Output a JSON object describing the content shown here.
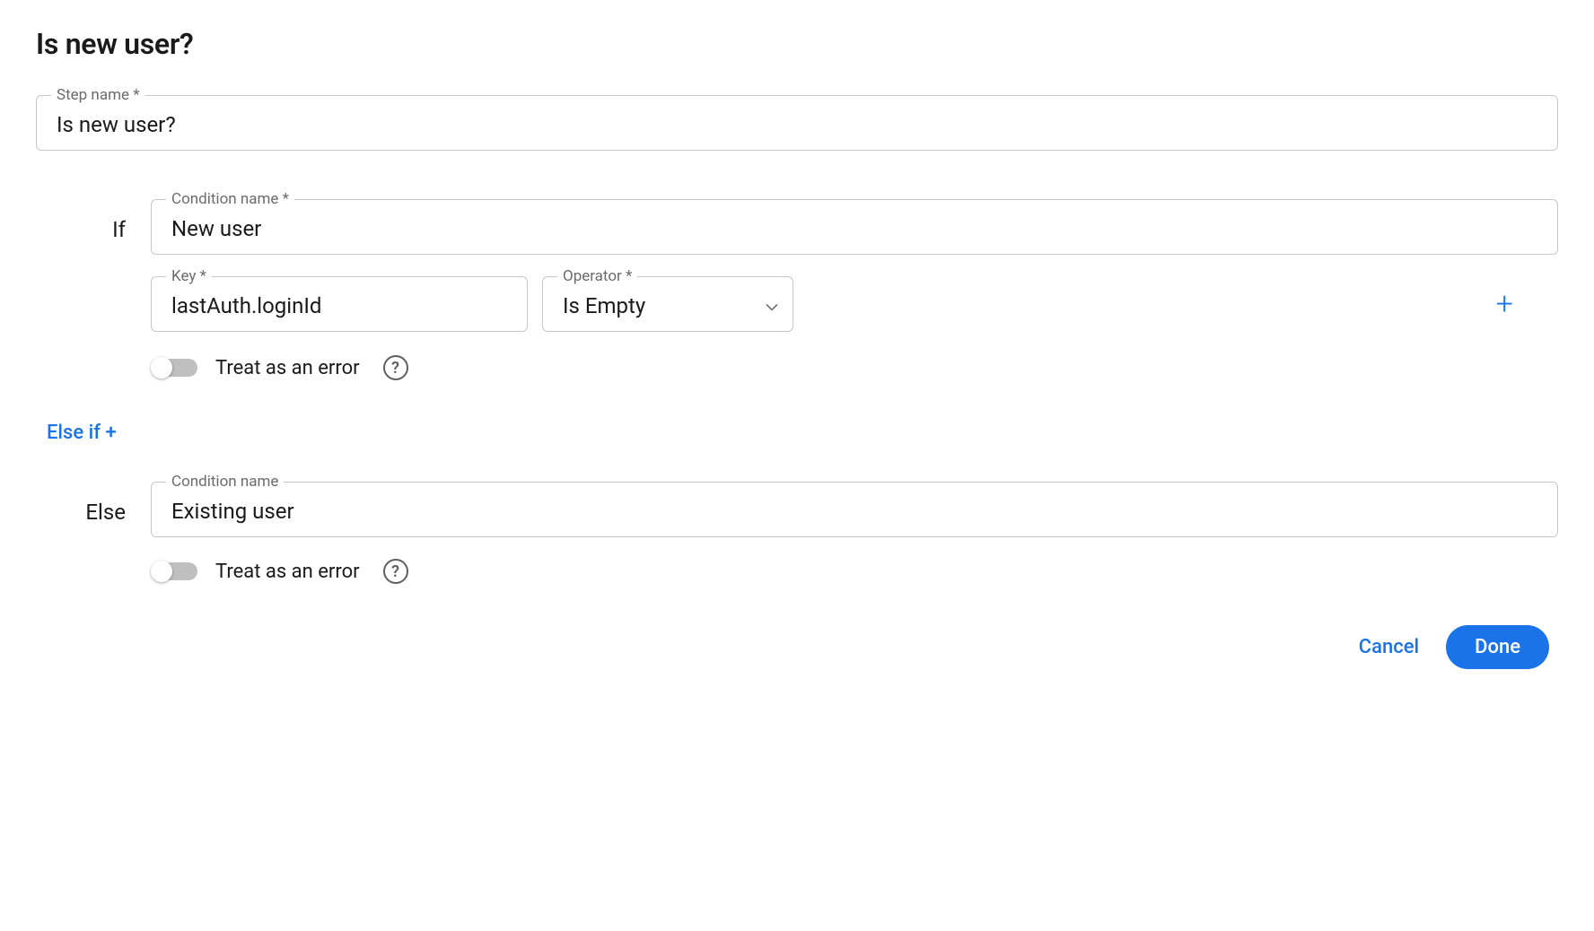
{
  "title": "Is new user?",
  "step_name": {
    "label": "Step name *",
    "value": "Is new user?"
  },
  "if_branch": {
    "label": "If",
    "condition_name": {
      "label": "Condition name *",
      "value": "New user"
    },
    "key": {
      "label": "Key *",
      "value": "lastAuth.loginId"
    },
    "operator": {
      "label": "Operator *",
      "value": "Is Empty"
    },
    "treat_as_error": {
      "label": "Treat as an error",
      "checked": false
    }
  },
  "else_if_link": "Else if +",
  "else_branch": {
    "label": "Else",
    "condition_name": {
      "label": "Condition name",
      "value": "Existing user"
    },
    "treat_as_error": {
      "label": "Treat as an error",
      "checked": false
    }
  },
  "footer": {
    "cancel": "Cancel",
    "done": "Done"
  },
  "help_glyph": "?"
}
